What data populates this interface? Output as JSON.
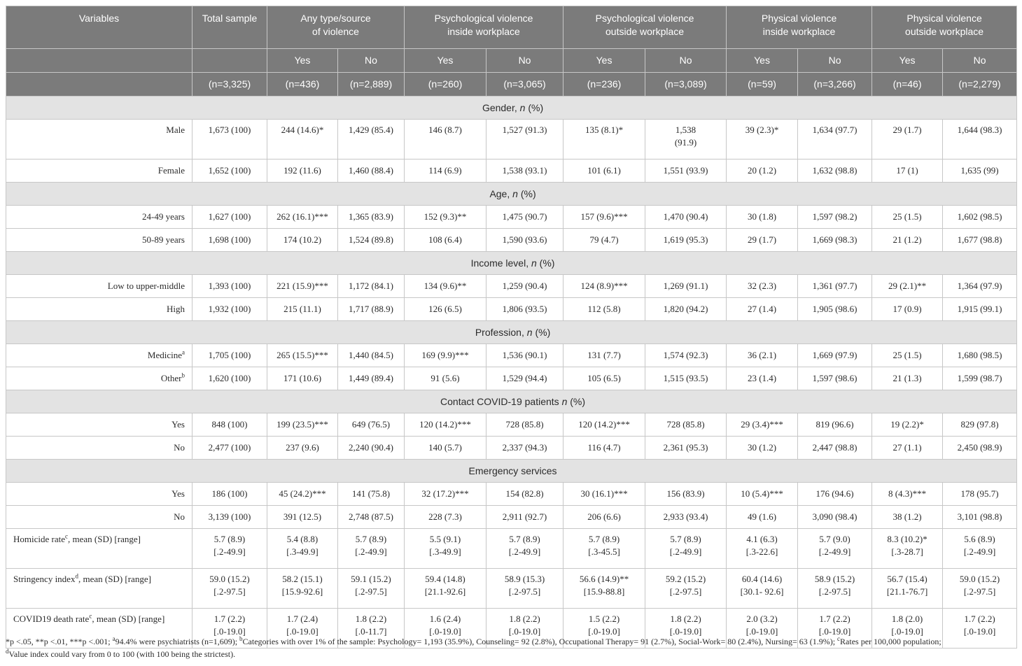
{
  "header": {
    "variables": "Variables",
    "total": "Total sample",
    "groups": [
      "Any type/source\nof violence",
      "Psychological violence\ninside workplace",
      "Psychological violence\noutside workplace",
      "Physical violence\ninside workplace",
      "Physical violence\noutside workplace"
    ],
    "yes": "Yes",
    "no": "No",
    "n_total": "(n=3,325)",
    "n_groups": [
      [
        "(n=436)",
        "(n=2,889)"
      ],
      [
        "(n=260)",
        "(n=3,065)"
      ],
      [
        "(n=236)",
        "(n=3,089)"
      ],
      [
        "(n=59)",
        "(n=3,266)"
      ],
      [
        "(n=46)",
        "(n=2,279)"
      ]
    ]
  },
  "sections": [
    {
      "title_parts": [
        "Gender, ",
        "n",
        " (%)"
      ],
      "rows": [
        {
          "label": "Male",
          "cells": [
            "1,673 (100)",
            "244 (14.6)*",
            "1,429 (85.4)",
            "146 (8.7)",
            "1,527 (91.3)",
            "135 (8.1)*",
            "1,538\n(91.9)",
            "39 (2.3)*",
            "1,634 (97.7)",
            "29 (1.7)",
            "1,644 (98.3)"
          ]
        },
        {
          "label": "Female",
          "cells": [
            "1,652 (100)",
            "192 (11.6)",
            "1,460 (88.4)",
            "114 (6.9)",
            "1,538 (93.1)",
            "101 (6.1)",
            "1,551 (93.9)",
            "20 (1.2)",
            "1,632 (98.8)",
            "17 (1)",
            "1,635 (99)"
          ]
        }
      ]
    },
    {
      "title_parts": [
        "Age, ",
        "n",
        " (%)"
      ],
      "rows": [
        {
          "label": "24-49 years",
          "cells": [
            "1,627 (100)",
            "262 (16.1)***",
            "1,365 (83.9)",
            "152 (9.3)**",
            "1,475 (90.7)",
            "157 (9.6)***",
            "1,470 (90.4)",
            "30 (1.8)",
            "1,597 (98.2)",
            "25 (1.5)",
            "1,602 (98.5)"
          ]
        },
        {
          "label": "50-89 years",
          "cells": [
            "1,698 (100)",
            "174 (10.2)",
            "1,524 (89.8)",
            "108 (6.4)",
            "1,590 (93.6)",
            "79 (4.7)",
            "1,619 (95.3)",
            "29 (1.7)",
            "1,669 (98.3)",
            "21 (1.2)",
            "1,677 (98.8)"
          ]
        }
      ]
    },
    {
      "title_parts": [
        "Income level, ",
        "n",
        " (%)"
      ],
      "rows": [
        {
          "label": "Low to upper-middle",
          "cells": [
            "1,393 (100)",
            "221 (15.9)***",
            "1,172 (84.1)",
            "134 (9.6)**",
            "1,259 (90.4)",
            "124 (8.9)***",
            "1,269 (91.1)",
            "32 (2.3)",
            "1,361 (97.7)",
            "29 (2.1)**",
            "1,364 (97.9)"
          ]
        },
        {
          "label": "High",
          "cells": [
            "1,932 (100)",
            "215 (11.1)",
            "1,717 (88.9)",
            "126 (6.5)",
            "1,806 (93.5)",
            "112 (5.8)",
            "1,820 (94.2)",
            "27 (1.4)",
            "1,905 (98.6)",
            "17 (0.9)",
            "1,915 (99.1)"
          ]
        }
      ]
    },
    {
      "title_parts": [
        "Profession, ",
        "n",
        " (%)"
      ],
      "rows": [
        {
          "label": "Medicine",
          "sup": "a",
          "cells": [
            "1,705 (100)",
            "265 (15.5)***",
            "1,440 (84.5)",
            "169 (9.9)***",
            "1,536 (90.1)",
            "131 (7.7)",
            "1,574 (92.3)",
            "36 (2.1)",
            "1,669 (97.9)",
            "25 (1.5)",
            "1,680 (98.5)"
          ]
        },
        {
          "label": "Other",
          "sup": "b",
          "cells": [
            "1,620 (100)",
            "171 (10.6)",
            "1,449 (89.4)",
            "91 (5.6)",
            "1,529 (94.4)",
            "105 (6.5)",
            "1,515 (93.5)",
            "23 (1.4)",
            "1,597 (98.6)",
            "21 (1.3)",
            "1,599 (98.7)"
          ]
        }
      ]
    },
    {
      "title_parts": [
        "Contact COVID-19 patients ",
        "n",
        " (%)"
      ],
      "rows": [
        {
          "label": "Yes",
          "cells": [
            "848 (100)",
            "199 (23.5)***",
            "649 (76.5)",
            "120 (14.2)***",
            "728 (85.8)",
            "120 (14.2)***",
            "728 (85.8)",
            "29 (3.4)***",
            "819 (96.6)",
            "19 (2.2)*",
            "829 (97.8)"
          ]
        },
        {
          "label": "No",
          "cells": [
            "2,477 (100)",
            "237 (9.6)",
            "2,240 (90.4)",
            "140 (5.7)",
            "2,337 (94.3)",
            "116 (4.7)",
            "2,361 (95.3)",
            "30 (1.2)",
            "2,447 (98.8)",
            "27 (1.1)",
            "2,450 (98.9)"
          ]
        }
      ]
    },
    {
      "title_parts": [
        "Emergency services",
        "",
        ""
      ],
      "rows": [
        {
          "label": "Yes",
          "cells": [
            "186 (100)",
            "45 (24.2)***",
            "141 (75.8)",
            "32 (17.2)***",
            "154 (82.8)",
            "30 (16.1)***",
            "156 (83.9)",
            "10 (5.4)***",
            "176 (94.6)",
            "8 (4.3)***",
            "178 (95.7)"
          ]
        },
        {
          "label": "No",
          "cells": [
            "3,139 (100)",
            "391 (12.5)",
            "2,748 (87.5)",
            "228 (7.3)",
            "2,911 (92.7)",
            "206 (6.6)",
            "2,933 (93.4)",
            "49 (1.6)",
            "3,090 (98.4)",
            "38 (1.2)",
            "3,101 (98.8)"
          ]
        }
      ]
    }
  ],
  "continuous": [
    {
      "label_pre": "Homicide rate",
      "sup": "c",
      "label_post": ", mean (SD) [range]",
      "cells": [
        [
          "5.7 (8.9)",
          "[.2-49.9]"
        ],
        [
          "5.4 (8.8)",
          "[.3-49.9]"
        ],
        [
          "5.7 (8.9)",
          "[.2-49.9]"
        ],
        [
          "5.5 (9.1)",
          "[.3-49.9]"
        ],
        [
          "5.7 (8.9)",
          "[.2-49.9]"
        ],
        [
          "5.7 (8.9)",
          "[.3-45.5]"
        ],
        [
          "5.7 (8.9)",
          "[.2-49.9]"
        ],
        [
          "4.1 (6.3)",
          "[.3-22.6]"
        ],
        [
          "5.7 (9.0)",
          "[.2-49.9]"
        ],
        [
          "8.3 (10.2)*",
          "[.3-28.7]"
        ],
        [
          "5.6 (8.9)",
          "[.2-49.9]"
        ]
      ]
    },
    {
      "label_pre": "Stringency index",
      "sup": "d",
      "label_post": ", mean (SD) [range]",
      "cells": [
        [
          "59.0 (15.2)",
          "[.2-97.5]"
        ],
        [
          "58.2 (15.1)",
          "[15.9-92.6]"
        ],
        [
          "59.1 (15.2)",
          "[.2-97.5]"
        ],
        [
          "59.4 (14.8)",
          "[21.1-92.6]"
        ],
        [
          "58.9 (15.3)",
          "[.2-97.5]"
        ],
        [
          "56.6 (14.9)**",
          "[15.9-88.8]"
        ],
        [
          "59.2 (15.2)",
          "[.2-97.5]"
        ],
        [
          "60.4 (14.6)",
          "[30.1- 92.6]"
        ],
        [
          "58.9 (15.2)",
          "[.2-97.5]"
        ],
        [
          "56.7 (15.4)",
          "[21.1-76.7]"
        ],
        [
          "59.0 (15.2)",
          "[.2-97.5]"
        ]
      ]
    },
    {
      "label_pre": "COVID19 death rate",
      "sup": "c",
      "label_post": ", mean (SD) [range]",
      "cells": [
        [
          "1.7 (2.2)",
          "[.0-19.0]"
        ],
        [
          "1.7 (2.4)",
          "[.0-19.0]"
        ],
        [
          "1.8 (2.2)",
          "[.0-11.7]"
        ],
        [
          "1.6 (2.4)",
          "[.0-19.0]"
        ],
        [
          "1.8 (2.2)",
          "[.0-19.0]"
        ],
        [
          "1.5 (2.2)",
          "[.0-19.0]"
        ],
        [
          "1.8 (2.2)",
          "[.0-19.0]"
        ],
        [
          "2.0 (3.2)",
          "[.0-19.0]"
        ],
        [
          "1.7 (2.2)",
          "[.0-19.0]"
        ],
        [
          "1.8 (2.0)",
          "[.0-19.0]"
        ],
        [
          "1.7 (2.2)",
          "[.0-19.0]"
        ]
      ]
    }
  ],
  "footnote": {
    "p1": "*p <.05, **p <.01, ***p <.001; ",
    "sa": "a",
    "p2": "94.4% were psychiatrists (n=1,609); ",
    "sb": "b",
    "p3": "Categories with over 1% of the sample: Psychology= 1,193 (35.9%), Counseling= 92 (2.8%), Occupational Therapy= 91 (2.7%), Social-Work= 80 (2.4%), Nursing= 63 (1.9%); ",
    "sc": "c",
    "p4": "Rates per 100,000 population;",
    "sd": "d",
    "p5": "Value index could vary from 0 to 100 (with 100 being the strictest)."
  }
}
